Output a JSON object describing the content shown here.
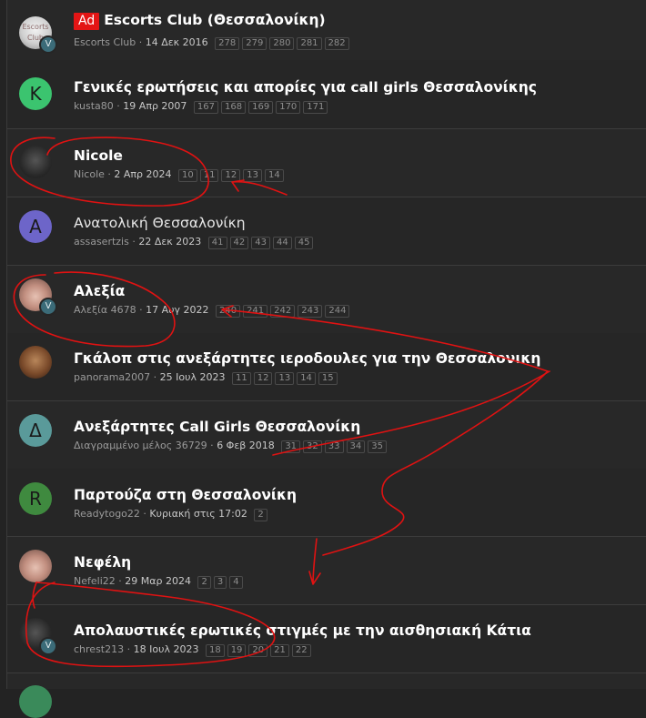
{
  "threads": [
    {
      "title": "Escorts Club (Θεσσαλονίκη)",
      "ad": "Ad",
      "author": "Escorts Club",
      "date": "14 Δεκ 2016",
      "pages": [
        "278",
        "279",
        "280",
        "281",
        "282"
      ],
      "avatar_text": "Escorts Club",
      "verified": "V",
      "avatar_style": "photo-white",
      "bold": true
    },
    {
      "title": "Γενικές ερωτήσεις και απορίες για call girls Θεσσαλονίκης",
      "author": "kusta80",
      "date": "19 Απρ 2007",
      "pages": [
        "167",
        "168",
        "169",
        "170",
        "171"
      ],
      "avatar_letter": "K",
      "avatar_color": "#3bc46f",
      "bold": true
    },
    {
      "title": "Nicole",
      "author": "Nicole",
      "date": "2 Απρ 2024",
      "pages": [
        "10",
        "11",
        "12",
        "13",
        "14"
      ],
      "avatar_style": "photo-dark",
      "bold": true
    },
    {
      "title": "Ανατολική Θεσσαλονίκη",
      "author": "assasertzis",
      "date": "22 Δεκ 2023",
      "pages": [
        "41",
        "42",
        "43",
        "44",
        "45"
      ],
      "avatar_letter": "A",
      "avatar_color": "#6d65c9",
      "bold": false
    },
    {
      "title": "Αλεξία",
      "author": "Αλεξία 4678",
      "date": "17 Αυγ 2022",
      "pages": [
        "240",
        "241",
        "242",
        "243",
        "244"
      ],
      "avatar_style": "photo-skin",
      "verified": "V",
      "bold": true
    },
    {
      "title": "Γκάλοπ στις ανεξάρτητες ιεροδουλες για την Θεσσαλονικη",
      "author": "panorama2007",
      "date": "25 Ιουλ 2023",
      "pages": [
        "11",
        "12",
        "13",
        "14",
        "15"
      ],
      "avatar_style": "photo-warm",
      "bold": true
    },
    {
      "title": "Ανεξάρτητες Call Girls Θεσσαλονίκη",
      "author": "Διαγραμμένο μέλος 36729",
      "date": "6 Φεβ 2018",
      "pages": [
        "31",
        "32",
        "33",
        "34",
        "35"
      ],
      "avatar_letter": "Δ",
      "avatar_color": "#5a9a9a",
      "bold": true
    },
    {
      "title": "Παρτούζα στη Θεσσαλονίκη",
      "author": "Readytogo22",
      "date": "Κυριακή στις 17:02",
      "pages": [
        "2"
      ],
      "avatar_letter": "R",
      "avatar_color": "#3f8a3f",
      "bold": true
    },
    {
      "title": "Νεφέλη",
      "author": "Nefeli22",
      "date": "29 Μαρ 2024",
      "pages": [
        "2",
        "3",
        "4"
      ],
      "avatar_style": "photo-skin",
      "bold": true
    },
    {
      "title": "Απολαυστικές ερωτικές στιγμές με την αισθησιακή Κάτια",
      "author": "chrest213",
      "date": "18 Ιουλ 2023",
      "pages": [
        "18",
        "19",
        "20",
        "21",
        "22"
      ],
      "avatar_style": "photo-dark",
      "verified": "V",
      "bold": true
    }
  ],
  "colors": {
    "annotation": "#e01212",
    "background": "#262626"
  }
}
